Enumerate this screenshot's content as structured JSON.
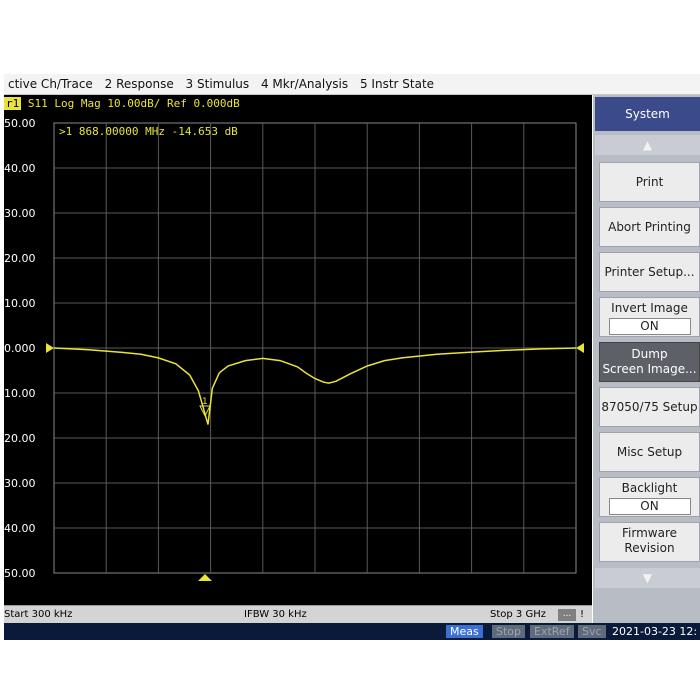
{
  "menu": {
    "items": [
      "ctive Ch/Trace",
      "2 Response",
      "3 Stimulus",
      "4 Mkr/Analysis",
      "5 Instr State"
    ]
  },
  "trace": {
    "badge": "r1",
    "title": "S11 Log Mag 10.00dB/ Ref 0.000dB",
    "color": "#e8e43a"
  },
  "marker": {
    "readout": ">1  868.00000 MHz -14.653 dB",
    "label": "1"
  },
  "y_axis": {
    "labels": [
      "50.00",
      "40.00",
      "30.00",
      "20.00",
      "10.00",
      "0.000",
      "10.00",
      "20.00",
      "30.00",
      "40.00",
      "50.00"
    ]
  },
  "status": {
    "start": "Start 300 kHz",
    "ifbw": "IFBW 30 kHz",
    "stop": "Stop 3 GHz",
    "dots": "...",
    "excl": "!"
  },
  "bottom": {
    "meas": "Meas",
    "stop": "Stop",
    "extref": "ExtRef",
    "svc": "Svc",
    "datetime": "2021-03-23 12:"
  },
  "softkeys": {
    "title": "System",
    "print": "Print",
    "abort_printing": "Abort Printing",
    "printer_setup": "Printer Setup...",
    "invert_image": "Invert Image",
    "invert_image_value": "ON",
    "dump_line1": "Dump",
    "dump_line2": "Screen Image...",
    "setup_87050": "87050/75 Setup",
    "misc_setup": "Misc Setup",
    "backlight": "Backlight",
    "backlight_value": "ON",
    "firmware_line1": "Firmware",
    "firmware_line2": "Revision",
    "up_arrow": "▲",
    "down_arrow": "▼"
  },
  "chart_data": {
    "type": "line",
    "title": "S11 Log Mag 10.00dB/ Ref 0.000dB",
    "xlabel": "",
    "ylabel": "",
    "xunit": "MHz",
    "yunit": "dB",
    "xlim": [
      0.3,
      3000
    ],
    "ylim": [
      -50,
      50
    ],
    "grid": true,
    "series": [
      {
        "color": "#e8e43a",
        "points": [
          [
            0.3,
            0
          ],
          [
            100,
            -0.2
          ],
          [
            200,
            -0.4
          ],
          [
            300,
            -0.7
          ],
          [
            400,
            -1.0
          ],
          [
            500,
            -1.4
          ],
          [
            600,
            -2.2
          ],
          [
            700,
            -3.5
          ],
          [
            780,
            -6.0
          ],
          [
            830,
            -9.5
          ],
          [
            860,
            -13.5
          ],
          [
            868,
            -14.653
          ],
          [
            885,
            -17.0
          ],
          [
            910,
            -9.0
          ],
          [
            950,
            -5.5
          ],
          [
            1000,
            -4.0
          ],
          [
            1100,
            -2.8
          ],
          [
            1200,
            -2.3
          ],
          [
            1300,
            -2.8
          ],
          [
            1400,
            -4.2
          ],
          [
            1450,
            -5.6
          ],
          [
            1500,
            -6.8
          ],
          [
            1550,
            -7.6
          ],
          [
            1580,
            -7.8
          ],
          [
            1620,
            -7.4
          ],
          [
            1700,
            -5.8
          ],
          [
            1800,
            -4.0
          ],
          [
            1900,
            -2.8
          ],
          [
            2000,
            -2.2
          ],
          [
            2200,
            -1.4
          ],
          [
            2400,
            -0.9
          ],
          [
            2600,
            -0.5
          ],
          [
            2800,
            -0.2
          ],
          [
            3000,
            0
          ]
        ]
      }
    ],
    "markers": [
      {
        "label": "1",
        "x": 868,
        "y": -14.653
      }
    ]
  }
}
